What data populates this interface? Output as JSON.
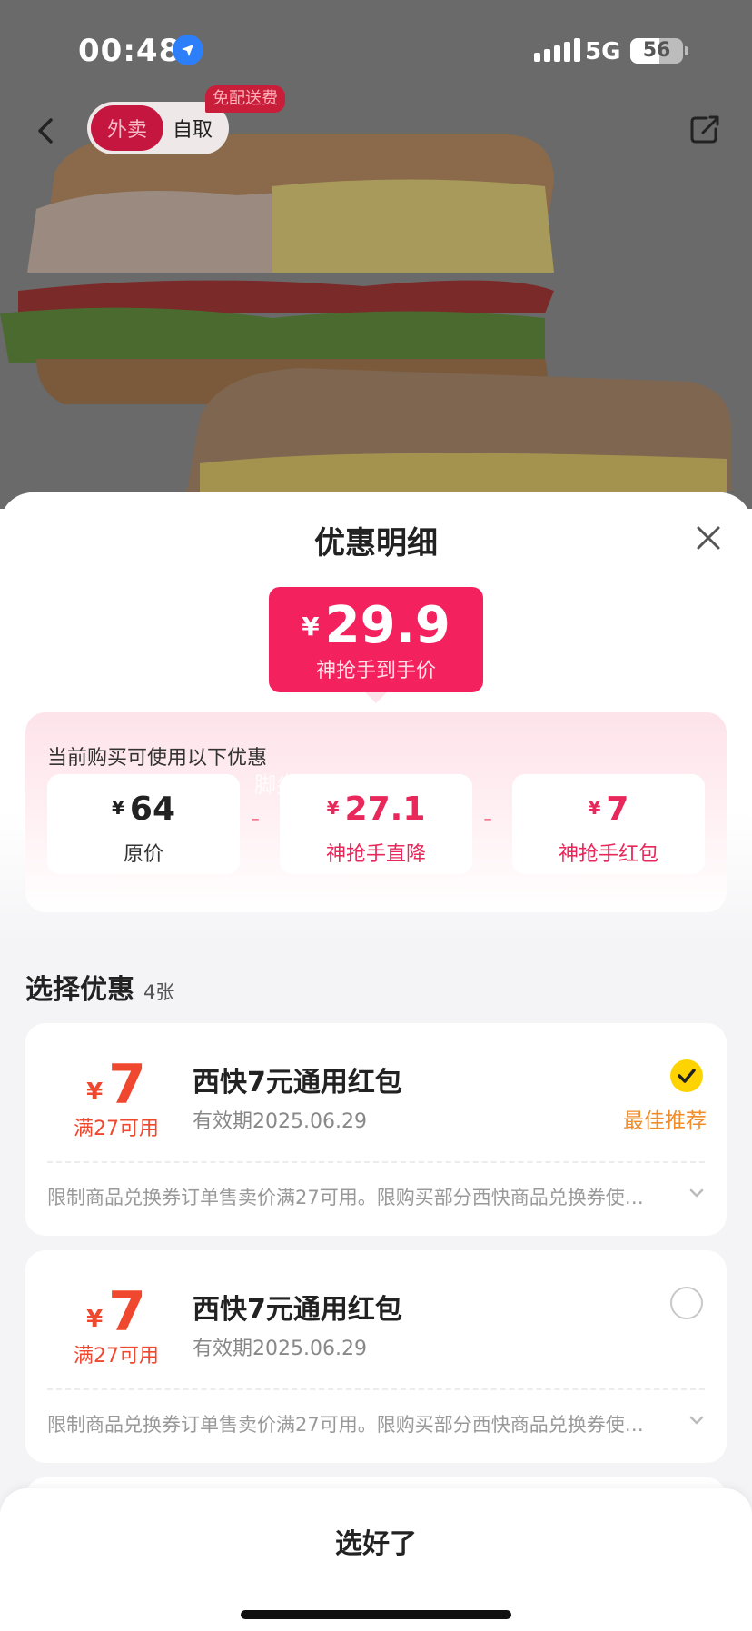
{
  "status_bar": {
    "time": "00:48",
    "network": "5G",
    "battery": "56",
    "battery_level": 0.56
  },
  "header": {
    "tab_delivery": "外卖",
    "tab_pickup": "自取",
    "free_delivery_badge": "免配送费"
  },
  "sheet": {
    "title": "优惠明细",
    "final_price": {
      "currency": "¥",
      "value": "29.9",
      "label": "神抢手到手价"
    },
    "available_label": "当前购买可使用以下优惠",
    "watermark": "脚尖上的老饕鼓菜",
    "breakdown": [
      {
        "currency": "¥",
        "value": "64",
        "label": "原价"
      },
      {
        "currency": "¥",
        "value": "27.1",
        "label": "神抢手直降"
      },
      {
        "currency": "¥",
        "value": "7",
        "label": "神抢手红包"
      }
    ],
    "operator": "-",
    "section_title": "选择优惠",
    "section_count": "4张",
    "coupons": [
      {
        "currency": "¥",
        "amount": "7",
        "condition": "满27可用",
        "name": "西快7元通用红包",
        "expiry": "有效期2025.06.29",
        "selected": true,
        "tag": "最佳推荐",
        "desc": "限制商品兑换券订单售卖价满27可用。限购买部分西快商品兑换券使…"
      },
      {
        "currency": "¥",
        "amount": "7",
        "condition": "满27可用",
        "name": "西快7元通用红包",
        "expiry": "有效期2025.06.29",
        "selected": false,
        "tag": "",
        "desc": "限制商品兑换券订单售卖价满27可用。限购买部分西快商品兑换券使…"
      }
    ],
    "confirm_label": "选好了"
  },
  "colors": {
    "accent": "#f3225e",
    "coupon_red": "#f0482f",
    "best_orange": "#f08c2b",
    "check_yellow": "#ffd300"
  }
}
